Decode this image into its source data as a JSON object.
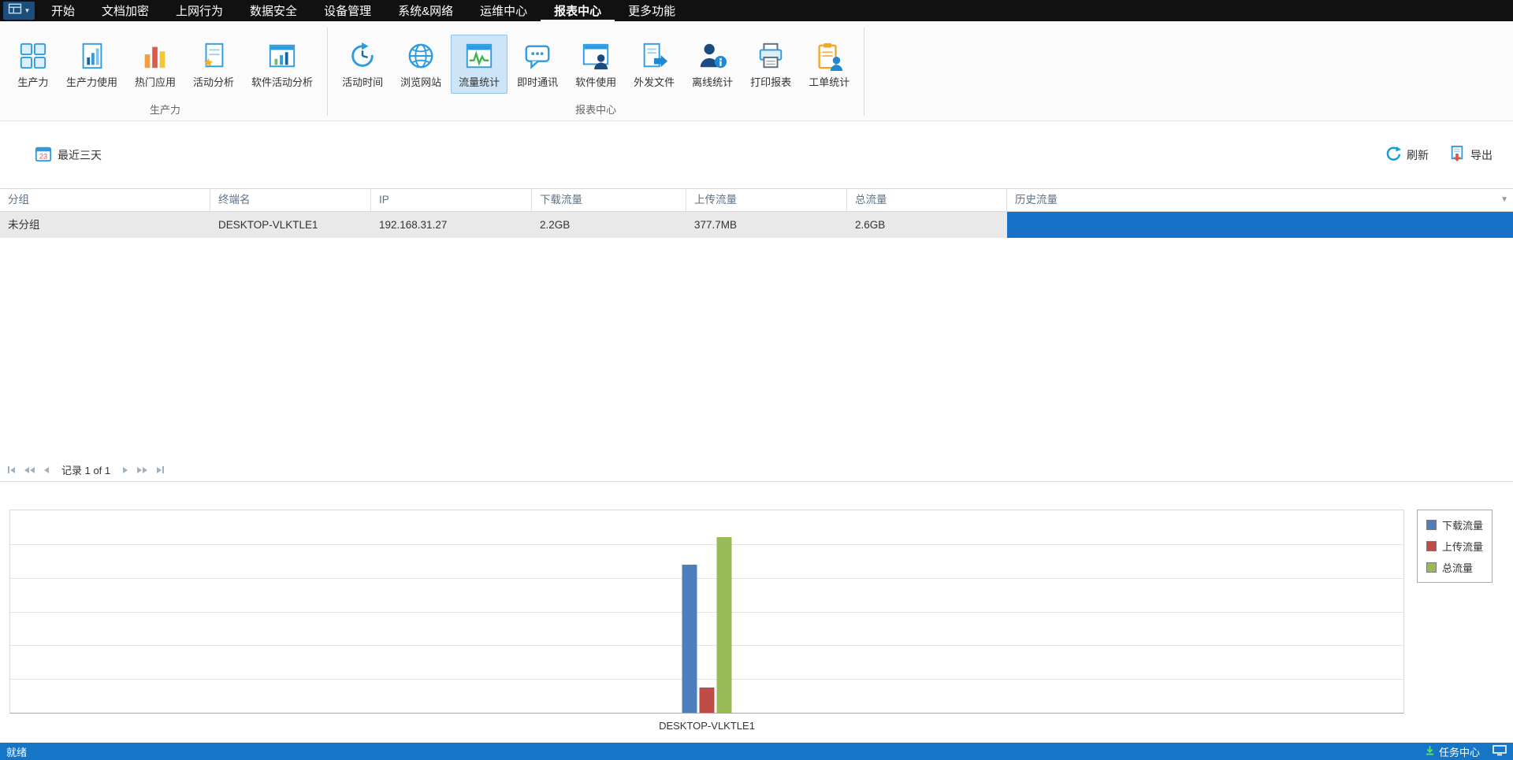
{
  "top_bar": {
    "tabs": [
      "开始",
      "文档加密",
      "上网行为",
      "数据安全",
      "设备管理",
      "系统&网络",
      "运维中心",
      "报表中心",
      "更多功能"
    ],
    "active_tab": "报表中心"
  },
  "ribbon": {
    "groups": [
      {
        "label": "生产力",
        "buttons": [
          {
            "label": "生产力",
            "icon": "grid-squares-icon"
          },
          {
            "label": "生产力使用",
            "icon": "document-bars-icon"
          },
          {
            "label": "热门应用",
            "icon": "colored-bars-icon"
          },
          {
            "label": "活动分析",
            "icon": "document-star-icon"
          },
          {
            "label": "软件活动分析",
            "icon": "window-chart-icon"
          }
        ]
      },
      {
        "label": "报表中心",
        "buttons": [
          {
            "label": "活动时间",
            "icon": "clock-refresh-icon"
          },
          {
            "label": "浏览网站",
            "icon": "globe-icon"
          },
          {
            "label": "流量统计",
            "icon": "traffic-chart-icon",
            "active": true
          },
          {
            "label": "即时通讯",
            "icon": "chat-bubble-icon"
          },
          {
            "label": "软件使用",
            "icon": "window-user-icon"
          },
          {
            "label": "外发文件",
            "icon": "document-arrow-icon"
          },
          {
            "label": "离线统计",
            "icon": "user-info-icon"
          },
          {
            "label": "打印报表",
            "icon": "printer-icon"
          },
          {
            "label": "工单统计",
            "icon": "clipboard-user-icon"
          }
        ]
      }
    ]
  },
  "toolbar": {
    "date_filter_label": "最近三天",
    "refresh_label": "刷新",
    "export_label": "导出"
  },
  "table": {
    "columns": [
      "分组",
      "终端名",
      "IP",
      "下载流量",
      "上传流量",
      "总流量",
      "历史流量"
    ],
    "rows": [
      {
        "group": "未分组",
        "terminal": "DESKTOP-VLKTLE1",
        "ip": "192.168.31.27",
        "download": "2.2GB",
        "upload": "377.7MB",
        "total": "2.6GB",
        "history_bar_percent": 100
      }
    ]
  },
  "pagination": {
    "label": "记录 1 of 1"
  },
  "chart_data": {
    "type": "bar",
    "title": "",
    "categories": [
      "DESKTOP-VLKTLE1"
    ],
    "series": [
      {
        "name": "下载流量",
        "values": [
          2.2
        ],
        "unit": "GB",
        "color": "#4e7fbc"
      },
      {
        "name": "上传流量",
        "values": [
          0.37
        ],
        "unit": "GB",
        "color": "#bf4b47"
      },
      {
        "name": "总流量",
        "values": [
          2.6
        ],
        "unit": "GB",
        "color": "#9aba57"
      }
    ],
    "ylim": [
      0,
      3
    ],
    "grid": true,
    "legend_position": "top-right"
  },
  "status_bar": {
    "left": "就绪",
    "task_center": "任务中心"
  },
  "colors": {
    "history_bar": "#1771c6",
    "statusbar": "#1576c8",
    "accent_blue": "#2d9be0",
    "selected_row": "#e9e9e9"
  }
}
